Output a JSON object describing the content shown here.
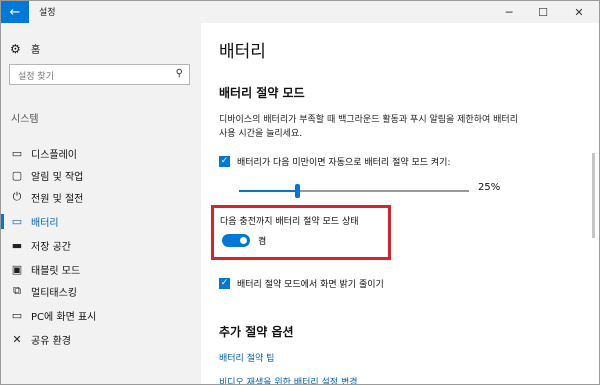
{
  "window": {
    "title": "설정",
    "back_icon": "back-arrow-icon",
    "minimize_symbol": "─",
    "maximize_symbol": "☐",
    "close_symbol": "✕"
  },
  "sidebar": {
    "home_label": "홈",
    "search_placeholder": "설정 찾기",
    "section_label": "시스템",
    "items": [
      {
        "label": "디스플레이",
        "icon": "display-icon",
        "glyph": "▭"
      },
      {
        "label": "알림 및 작업",
        "icon": "notification-icon",
        "glyph": "▢"
      },
      {
        "label": "전원 및 절전",
        "icon": "power-icon",
        "glyph": "⏻"
      },
      {
        "label": "배터리",
        "icon": "battery-icon",
        "glyph": "▭",
        "active": true
      },
      {
        "label": "저장 공간",
        "icon": "storage-icon",
        "glyph": "▬"
      },
      {
        "label": "태블릿 모드",
        "icon": "tablet-mode-icon",
        "glyph": "▣"
      },
      {
        "label": "멀티태스킹",
        "icon": "multitasking-icon",
        "glyph": "⧉"
      },
      {
        "label": "PC에 화면 표시",
        "icon": "project-icon",
        "glyph": "▭"
      },
      {
        "label": "공유 환경",
        "icon": "shared-experience-icon",
        "glyph": "✕"
      }
    ]
  },
  "main": {
    "title": "배터리",
    "saver_heading": "배터리 절약 모드",
    "saver_description": "디바이스의 배터리가 부족할 때 백그라운드 활동과 푸시 알림을 제한하여 배터리 사용 시간을 늘리세요.",
    "auto_on_label": "배터리가 다음 미만이면 자동으로 배터리 절약 모드 켜기:",
    "auto_on_checked": true,
    "threshold_percent": 25,
    "threshold_label": "25%",
    "status_label": "다음 충전까지 배터리 절약 모드 상태",
    "status_toggle_on": true,
    "status_value": "켬",
    "dim_label": "배터리 절약 모드에서 화면 밝기 줄이기",
    "dim_checked": true,
    "more_heading": "추가 절약 옵션",
    "links": [
      "배터리 절약 팁",
      "비디오 재생을 위한 배터리 설정 변경"
    ]
  },
  "colors": {
    "accent": "#0078d7",
    "highlight_box": "#d9222a"
  }
}
